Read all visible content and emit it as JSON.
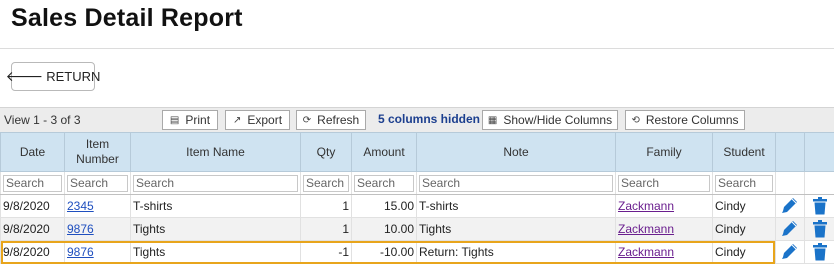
{
  "page": {
    "title": "Sales Detail Report",
    "return_label": "RETURN"
  },
  "toolbar": {
    "view_count": "View 1 - 3 of 3",
    "print_label": "Print",
    "export_label": "Export",
    "refresh_label": "Refresh",
    "hidden_note": "5 columns hidden",
    "show_hide_label": "Show/Hide Columns",
    "restore_label": "Restore Columns"
  },
  "table": {
    "headers": {
      "date": "Date",
      "item_number_1": "Item",
      "item_number_2": "Number",
      "item_name": "Item Name",
      "qty": "Qty",
      "amount": "Amount",
      "note": "Note",
      "family": "Family",
      "student": "Student"
    },
    "filter_placeholder": "Search",
    "rows": [
      {
        "date": "9/8/2020",
        "item_number": "2345",
        "item_name": "T-shirts",
        "qty": "1",
        "amount": "15.00",
        "note": "T-shirts",
        "family": "Zackmann",
        "student": "Cindy"
      },
      {
        "date": "9/8/2020",
        "item_number": "9876",
        "item_name": "Tights",
        "qty": "1",
        "amount": "10.00",
        "note": "Tights",
        "family": "Zackmann",
        "student": "Cindy"
      },
      {
        "date": "9/8/2020",
        "item_number": "9876",
        "item_name": "Tights",
        "qty": "-1",
        "amount": "-10.00",
        "note": "Return: Tights",
        "family": "Zackmann",
        "student": "Cindy"
      }
    ]
  },
  "colors": {
    "header_bg": "#cfe3f1",
    "link": "#1f4fbf",
    "family_link": "#6a1e8e",
    "highlight": "#e8a51c",
    "action_icon": "#1a73c9"
  },
  "icons": {
    "edit": "pencil-icon",
    "delete": "trash-icon"
  }
}
